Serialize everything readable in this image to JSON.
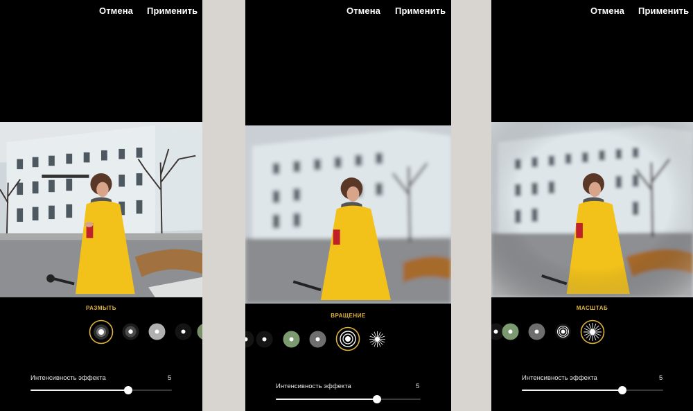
{
  "panels": [
    {
      "cancel_label": "Отмена",
      "apply_label": "Применить",
      "mode_label": "РАЗМЫТЬ",
      "slider": {
        "label": "Интенсивность эффекта",
        "value": "5",
        "level": 0.69
      }
    },
    {
      "cancel_label": "Отмена",
      "apply_label": "Применить",
      "mode_label": "ВРАЩЕНИЕ",
      "slider": {
        "label": "Интенсивность эффекта",
        "value": "5",
        "level": 0.7
      }
    },
    {
      "cancel_label": "Отмена",
      "apply_label": "Применить",
      "mode_label": "МАСШТАБ",
      "slider": {
        "label": "Интенсивность эффекта",
        "value": "5",
        "level": 0.71
      }
    }
  ],
  "effect_icons": [
    "blur-dot-icon",
    "small-dot-icon",
    "gray-disc-icon",
    "tiny-dot-icon",
    "green-disc-icon",
    "rings-icon",
    "radial-rays-icon"
  ],
  "colors": {
    "accent": "#e0b43c",
    "panel_bg": "#000000",
    "page_bg": "#d8d5d1",
    "coat": "#f2c21b"
  }
}
